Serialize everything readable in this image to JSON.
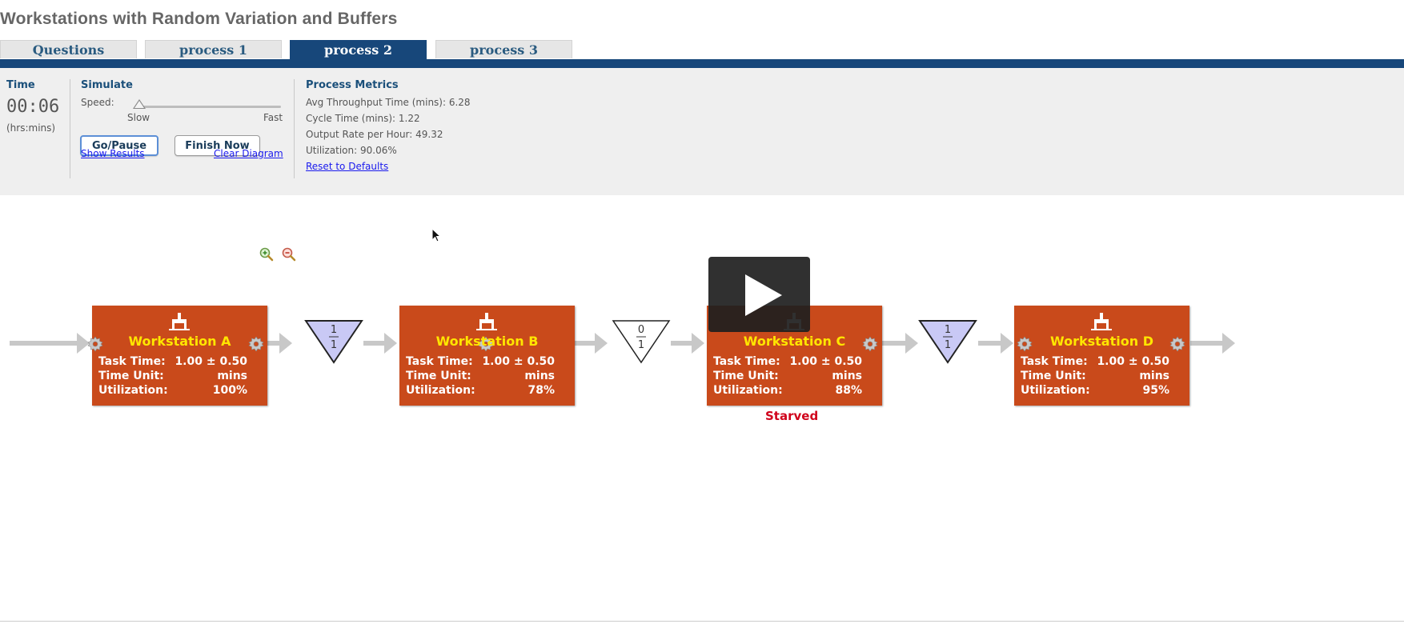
{
  "page": {
    "title": "Workstations with Random Variation and Buffers"
  },
  "tabs": [
    {
      "label": "Questions",
      "active": false
    },
    {
      "label": "process 1",
      "active": false
    },
    {
      "label": "process 2",
      "active": true
    },
    {
      "label": "process 3",
      "active": false
    }
  ],
  "time": {
    "heading": "Time",
    "value": "00:06",
    "unit": "(hrs:mins)"
  },
  "simulate": {
    "heading": "Simulate",
    "speed_label": "Speed:",
    "slow_label": "Slow",
    "fast_label": "Fast",
    "speed_level": 0.0,
    "go_pause_label": "Go/Pause",
    "finish_now_label": "Finish Now",
    "show_results_label": "Show Results",
    "clear_diagram_label": "Clear Diagram"
  },
  "metrics": {
    "heading": "Process Metrics",
    "lines": [
      "Avg Throughput Time (mins): 6.28",
      "Cycle Time (mins): 1.22",
      "Output Rate per Hour: 49.32",
      "Utilization: 90.06%"
    ],
    "reset_label": "Reset to Defaults"
  },
  "workstations": [
    {
      "title": "Workstation A",
      "task_time_label": "Task Time:",
      "task_time": "1.00 ± 0.50",
      "time_unit_label": "Time Unit:",
      "time_unit": "mins",
      "util_label": "Utilization:",
      "utilization": "100%"
    },
    {
      "title": "Workstation B",
      "task_time_label": "Task Time:",
      "task_time": "1.00 ± 0.50",
      "time_unit_label": "Time Unit:",
      "time_unit": "mins",
      "util_label": "Utilization:",
      "utilization": "78%"
    },
    {
      "title": "Workstation C",
      "task_time_label": "Task Time:",
      "task_time": "1.00 ± 0.50",
      "time_unit_label": "Time Unit:",
      "time_unit": "mins",
      "util_label": "Utilization:",
      "utilization": "88%",
      "status": "Starved"
    },
    {
      "title": "Workstation D",
      "task_time_label": "Task Time:",
      "task_time": "1.00 ± 0.50",
      "time_unit_label": "Time Unit:",
      "time_unit": "mins",
      "util_label": "Utilization:",
      "utilization": "95%"
    }
  ],
  "buffers": [
    {
      "count": "1",
      "capacity": "1",
      "fill": "#c9c9f5"
    },
    {
      "count": "0",
      "capacity": "1",
      "fill": "#ffffff"
    },
    {
      "count": "1",
      "capacity": "1",
      "fill": "#c9c9f5"
    }
  ],
  "colors": {
    "accent": "#17477a",
    "workstation": "#c94a1b",
    "workstation_title": "#ffe600",
    "starved": "#d0021b",
    "link": "#1a1aee"
  }
}
